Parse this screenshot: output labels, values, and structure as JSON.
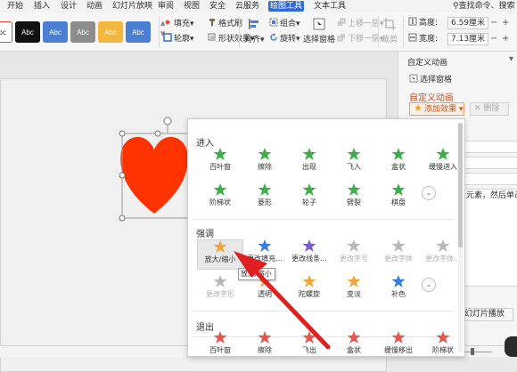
{
  "menu": {
    "tabs": [
      "开始",
      "插入",
      "设计",
      "动画",
      "幻灯片放映",
      "审阅",
      "视图",
      "安全",
      "云服务",
      "绘图工具",
      "文本工具"
    ],
    "active": "绘图工具",
    "search": "查找命令、搜索"
  },
  "ribbon": {
    "style_swatches": [
      {
        "label": "Abc",
        "bg": "#ffffff",
        "fg": "#333333",
        "border": "#e8473a"
      },
      {
        "label": "Abc",
        "bg": "#111111",
        "fg": "#ffffff",
        "border": "#111111"
      },
      {
        "label": "Abc",
        "bg": "#4a7fd4",
        "fg": "#ffffff",
        "border": "#4a7fd4"
      },
      {
        "label": "Abc",
        "bg": "#8c8c8c",
        "fg": "#ffffff",
        "border": "#8c8c8c"
      },
      {
        "label": "Abc",
        "bg": "#f4b63c",
        "fg": "#ffffff",
        "border": "#f4b63c"
      },
      {
        "label": "Abc",
        "bg": "#4a7fd4",
        "fg": "#ffffff",
        "border": "#4a7fd4"
      }
    ],
    "fill": "填充",
    "format_painter": "格式刷",
    "outline": "轮廓",
    "shape_effect": "形状效果",
    "align": "对齐",
    "group": "组合",
    "rotate": "旋转",
    "select_pane": "选择窗格",
    "bring_forward": "上移一层",
    "send_backward": "下移一层",
    "crop": "裁剪",
    "height_label": "高度:",
    "height_value": "6.59厘米",
    "width_label": "宽度:",
    "width_value": "7.13厘米"
  },
  "pane": {
    "title": "自定义动画",
    "select_pane": "选择窗格",
    "section": "自定义动画",
    "add_effect": "添加效果",
    "delete": "删除",
    "hint_text": "个元素，然后单击",
    "play": "幻灯片播放"
  },
  "dropdown": {
    "sections": [
      {
        "title": "进入",
        "effects": [
          {
            "label": "百叶窗",
            "color": "#3fae49",
            "dim": false
          },
          {
            "label": "擦除",
            "color": "#3fae49",
            "dim": false
          },
          {
            "label": "出现",
            "color": "#3fae49",
            "dim": false
          },
          {
            "label": "飞入",
            "color": "#3fae49",
            "dim": false
          },
          {
            "label": "盒状",
            "color": "#3fae49",
            "dim": false
          },
          {
            "label": "缓慢进入",
            "color": "#3fae49",
            "dim": false
          },
          {
            "label": "阶梯状",
            "color": "#3fae49",
            "dim": false
          },
          {
            "label": "菱形",
            "color": "#3fae49",
            "dim": false
          },
          {
            "label": "轮子",
            "color": "#3fae49",
            "dim": false
          },
          {
            "label": "劈裂",
            "color": "#3fae49",
            "dim": false
          },
          {
            "label": "棋盘",
            "color": "#3fae49",
            "dim": false
          }
        ]
      },
      {
        "title": "强调",
        "effects": [
          {
            "label": "放大/缩小",
            "color": "#f0a63a",
            "dim": false
          },
          {
            "label": "更改填充...",
            "color": "#3a7be0",
            "dim": false
          },
          {
            "label": "更改线条...",
            "color": "#7d5bd0",
            "dim": false
          },
          {
            "label": "更改字号",
            "color": "#b8b8b8",
            "dim": true
          },
          {
            "label": "更改字体",
            "color": "#b8b8b8",
            "dim": true
          },
          {
            "label": "更改字体...",
            "color": "#b8b8b8",
            "dim": true
          },
          {
            "label": "更改字形",
            "color": "#b8b8b8",
            "dim": true
          },
          {
            "label": "透明",
            "color": "#f0a63a",
            "dim": false
          },
          {
            "label": "陀螺旋",
            "color": "#f0a63a",
            "dim": false
          },
          {
            "label": "变淡",
            "color": "#f0a63a",
            "dim": false
          },
          {
            "label": "补色",
            "color": "#3a7be0",
            "dim": false
          }
        ]
      },
      {
        "title": "退出",
        "effects": [
          {
            "label": "百叶窗",
            "color": "#e8554b",
            "dim": false
          },
          {
            "label": "擦除",
            "color": "#e8554b",
            "dim": false
          },
          {
            "label": "飞出",
            "color": "#e8554b",
            "dim": false
          },
          {
            "label": "盒状",
            "color": "#e8554b",
            "dim": false
          },
          {
            "label": "缓慢移出",
            "color": "#e8554b",
            "dim": false
          },
          {
            "label": "阶梯状",
            "color": "#e8554b",
            "dim": false
          }
        ]
      }
    ],
    "tooltip": "放大/缩小"
  },
  "colors": {
    "accent": "#2f6ad6",
    "heart": "#ff3300",
    "arrow": "#e02020"
  }
}
